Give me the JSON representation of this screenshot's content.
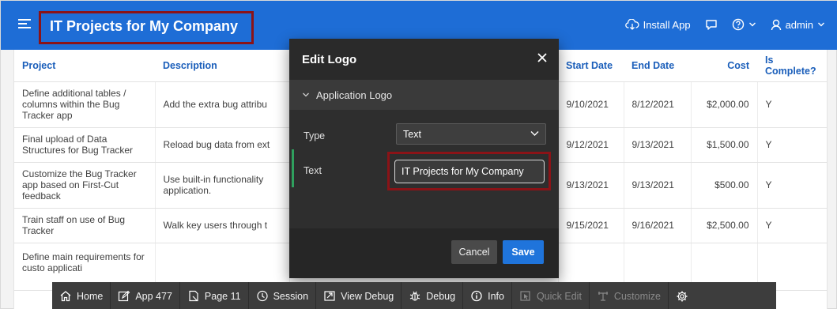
{
  "header": {
    "app_title": "IT Projects for My Company",
    "install_app_label": "Install App",
    "user_label": "admin"
  },
  "table": {
    "columns": [
      "Project",
      "Description",
      "",
      "Start Date",
      "End Date",
      "Cost",
      "Is Complete?"
    ],
    "rows": [
      {
        "project": "Define additional tables / columns within the Bug Tracker app",
        "description": "Add the extra bug attribu",
        "start": "9/10/2021",
        "end": "8/12/2021",
        "cost": "$2,000.00",
        "complete": "Y"
      },
      {
        "project": "Final upload of Data Structures for Bug Tracker",
        "description": "Reload bug data from ext",
        "start": "9/12/2021",
        "end": "9/13/2021",
        "cost": "$1,500.00",
        "complete": "Y"
      },
      {
        "project": "Customize the Bug Tracker app based on First-Cut feedback",
        "description": "Use built-in functionality application.",
        "start": "9/13/2021",
        "end": "9/13/2021",
        "cost": "$500.00",
        "complete": "Y"
      },
      {
        "project": "Train staff on use of Bug Tracker",
        "description": "Walk key users through t",
        "start": "9/15/2021",
        "end": "9/16/2021",
        "cost": "$2,500.00",
        "complete": "Y"
      },
      {
        "project": "Define main requirements for custo applicati",
        "description": "",
        "start": "",
        "end": "",
        "cost": "",
        "complete": ""
      }
    ]
  },
  "dialog": {
    "title": "Edit Logo",
    "region_title": "Application Logo",
    "type_label": "Type",
    "type_value": "Text",
    "text_label": "Text",
    "text_value": "IT Projects for My Company",
    "cancel_label": "Cancel",
    "save_label": "Save"
  },
  "devbar": {
    "items": [
      {
        "label": "Home",
        "icon": "home-icon"
      },
      {
        "label": "App 477",
        "icon": "edit-icon"
      },
      {
        "label": "Page 11",
        "icon": "page-icon"
      },
      {
        "label": "Session",
        "icon": "session-icon"
      },
      {
        "label": "View Debug",
        "icon": "view-debug-icon"
      },
      {
        "label": "Debug",
        "icon": "bug-icon"
      },
      {
        "label": "Info",
        "icon": "info-icon"
      },
      {
        "label": "Quick Edit",
        "icon": "quick-edit-icon"
      },
      {
        "label": "Customize",
        "icon": "customize-icon"
      }
    ]
  },
  "colors": {
    "header_bg": "#1e6dd6",
    "highlight_outline": "#8b1317",
    "save_button": "#1f74db",
    "link_blue": "#1a5eba"
  }
}
